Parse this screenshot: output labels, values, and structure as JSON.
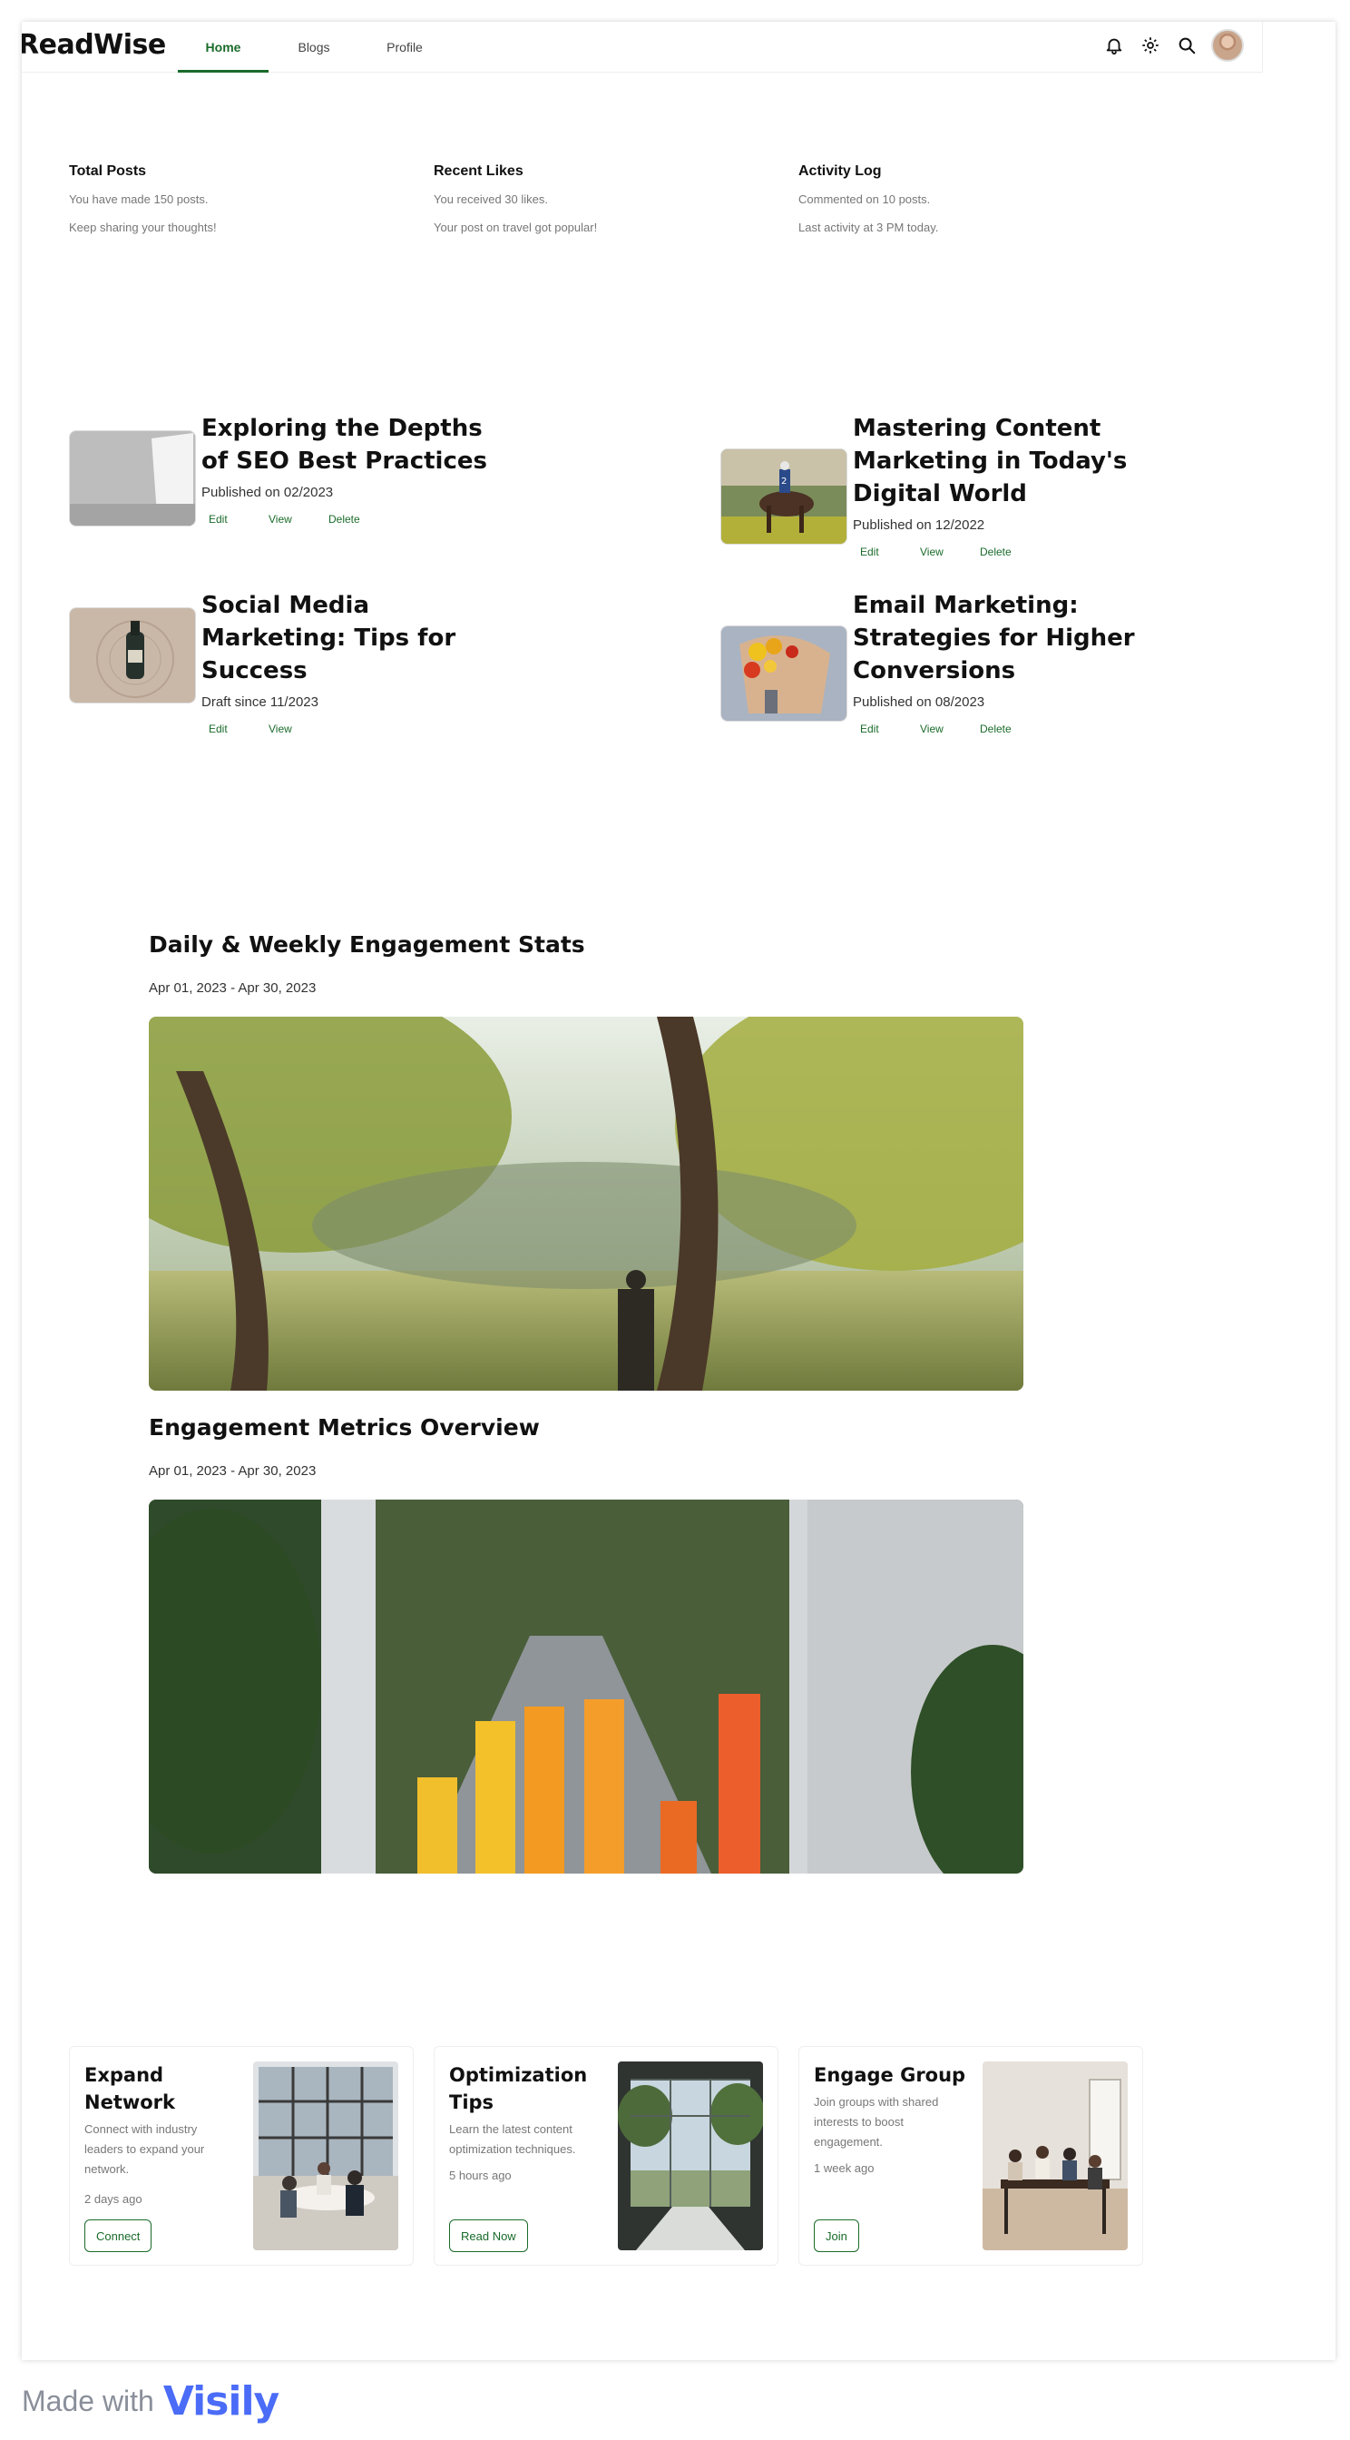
{
  "app": {
    "logo": "ReadWise"
  },
  "nav": {
    "tabs": [
      {
        "label": "Home"
      },
      {
        "label": "Blogs"
      },
      {
        "label": "Profile"
      }
    ]
  },
  "stats": [
    {
      "title": "Total Posts",
      "line1": "You have made 150 posts.",
      "line2": "Keep sharing your thoughts!"
    },
    {
      "title": "Recent Likes",
      "line1": "You received 30 likes.",
      "line2": "Your post on travel got popular!"
    },
    {
      "title": "Activity Log",
      "line1": "Commented on 10 posts.",
      "line2": "Last activity at 3 PM today."
    }
  ],
  "posts": [
    {
      "title": "Exploring the Depths of SEO Best Practices",
      "meta": "Published on 02/2023",
      "actions": [
        "Edit",
        "View",
        "Delete"
      ]
    },
    {
      "title": "Mastering Content Marketing in Today's Digital World",
      "meta": "Published on 12/2022",
      "actions": [
        "Edit",
        "View",
        "Delete"
      ]
    },
    {
      "title": "Social Media Marketing: Tips for Success",
      "meta": "Draft since 11/2023",
      "actions": [
        "Edit",
        "View"
      ]
    },
    {
      "title": "Email Marketing: Strategies for Higher Conversions",
      "meta": "Published on 08/2023",
      "actions": [
        "Edit",
        "View",
        "Delete"
      ]
    }
  ],
  "engagement": {
    "daily_title": "Daily & Weekly Engagement Stats",
    "daily_date": "Apr 01, 2023 - Apr 30, 2023",
    "overview_title": "Engagement Metrics Overview",
    "overview_date": "Apr 01, 2023 - Apr 30, 2023"
  },
  "cards": [
    {
      "title": "Expand Network",
      "desc": "Connect with industry leaders to expand your network.",
      "time": "2 days ago",
      "button": "Connect"
    },
    {
      "title": "Optimization Tips",
      "desc": "Learn the latest content optimization techniques.",
      "time": "5 hours ago",
      "button": "Read Now"
    },
    {
      "title": "Engage Group",
      "desc": "Join groups with shared interests to boost engagement.",
      "time": "1 week ago",
      "button": "Join"
    }
  ],
  "footer": {
    "made_with": "Made with",
    "brand": "Visily"
  },
  "colors": {
    "accent": "#1a6b2a",
    "muted": "#777777"
  },
  "icons": [
    "bell-icon",
    "gear-icon",
    "search-icon",
    "avatar"
  ]
}
